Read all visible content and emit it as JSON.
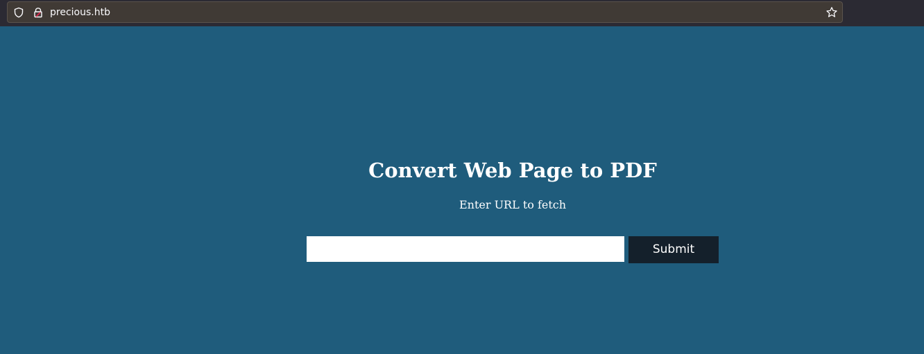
{
  "browser": {
    "url": "precious.htb",
    "icons": [
      "shield-icon",
      "lock-icon",
      "star-icon"
    ],
    "colors": {
      "toolbar": "#2b2a33",
      "url_box": "#403a35",
      "lock_accent": "#e22850"
    }
  },
  "page": {
    "title": "Convert Web Page to PDF",
    "subtitle": "Enter URL to fetch",
    "form": {
      "url_value": "",
      "url_placeholder": "",
      "submit_label": "Submit"
    },
    "colors": {
      "background": "#1f5c7c",
      "input_background": "#ffffff",
      "button_background": "#14202b",
      "text": "#ffffff"
    }
  }
}
